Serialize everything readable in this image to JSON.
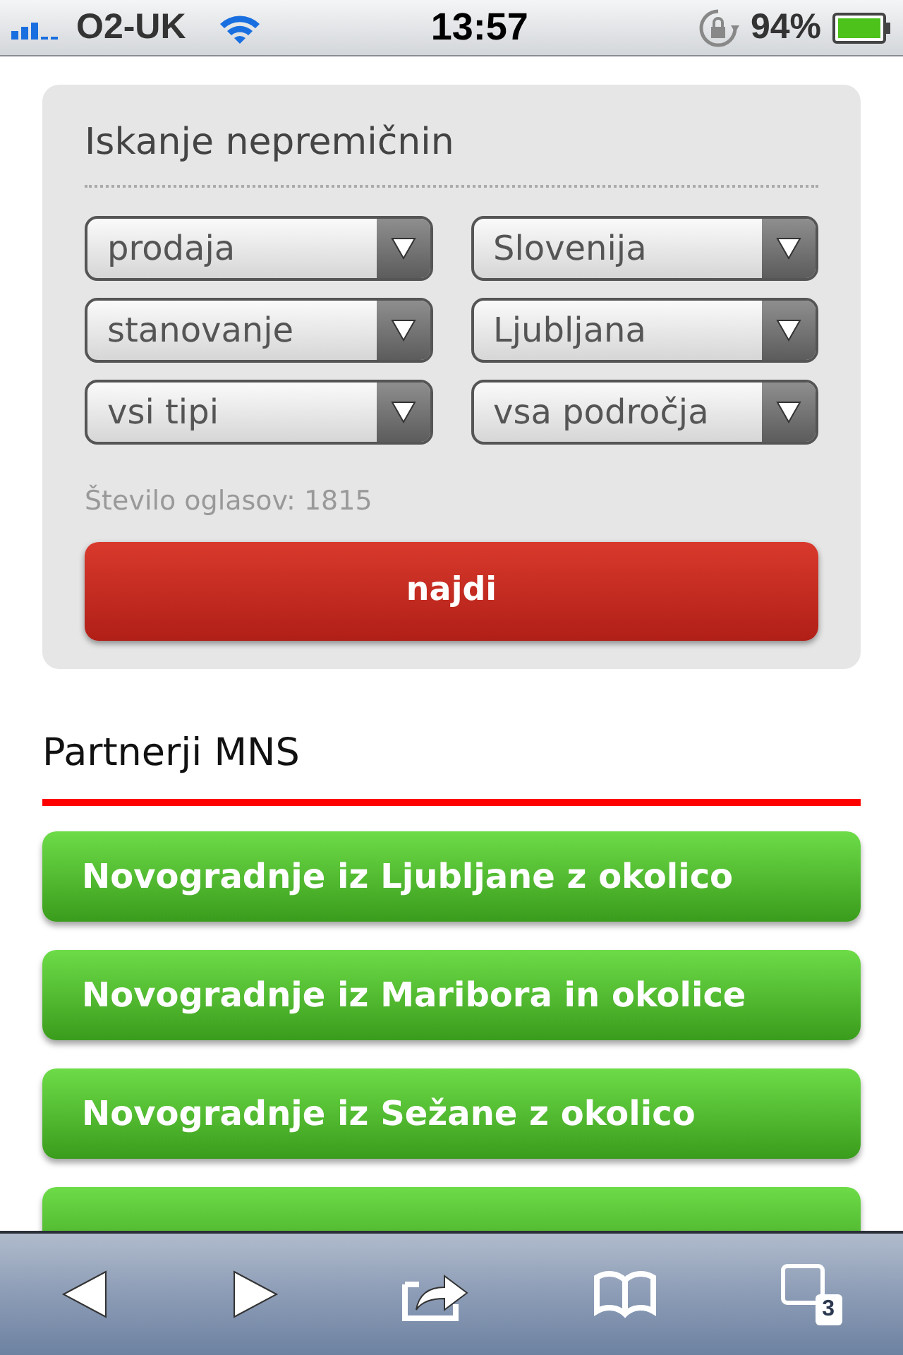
{
  "status_bar": {
    "carrier": "O2-UK",
    "time": "13:57",
    "battery_percent": "94%"
  },
  "search_panel": {
    "title": "Iskanje nepremičnin",
    "dropdowns": [
      {
        "value": "prodaja"
      },
      {
        "value": "Slovenija"
      },
      {
        "value": "stanovanje"
      },
      {
        "value": "Ljubljana"
      },
      {
        "value": "vsi tipi"
      },
      {
        "value": "vsa področja"
      }
    ],
    "count_label": "Število oglasov: 1815",
    "submit": "najdi"
  },
  "partners": {
    "title": "Partnerji MNS",
    "links": [
      "Novogradnje iz Ljubljane z okolico",
      "Novogradnje iz Maribora in okolice",
      "Novogradnje iz Sežane z okolico"
    ]
  },
  "toolbar": {
    "tabs_count": "3"
  }
}
